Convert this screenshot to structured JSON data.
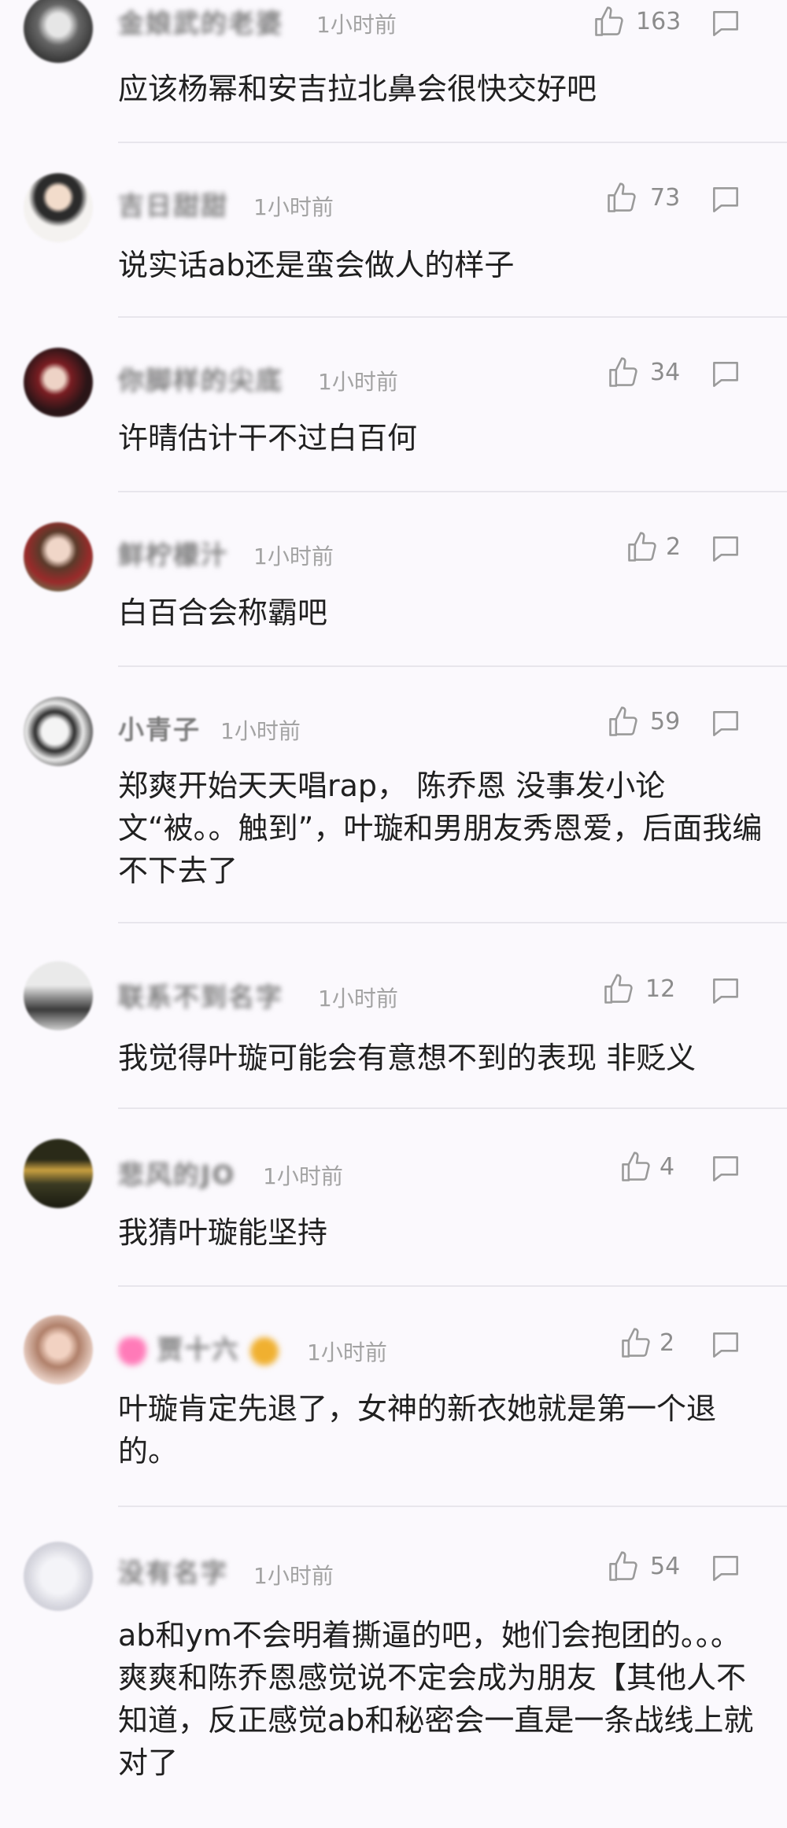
{
  "colors": {
    "background": "#fbf9fd",
    "text": "#202020",
    "meta": "#a3a3a3",
    "divider": "#e8e6ec"
  },
  "icons": {
    "like": "thumbs-up-outline-icon",
    "reply": "speech-bubble-outline-icon"
  },
  "comments": [
    {
      "username": "金娘武的老婆",
      "time": "1小时前",
      "likes": "163",
      "text": "应该杨幂和安吉拉北鼻会很快交好吧"
    },
    {
      "username": "吉日甜甜",
      "time": "1小时前",
      "likes": "73",
      "text": "说实话ab还是蛮会做人的样子"
    },
    {
      "username": "你脚样的尖底",
      "time": "1小时前",
      "likes": "34",
      "text": "许晴估计干不过白百何"
    },
    {
      "username": "鲜柠檬汁",
      "time": "1小时前",
      "likes": "2",
      "text": "白百合会称霸吧"
    },
    {
      "username": "小青子",
      "time": "1小时前",
      "likes": "59",
      "text": "郑爽开始天天唱rap， 陈乔恩 没事发小论文“被。。触到”，叶璇和男朋友秀恩爱，后面我编不下去了"
    },
    {
      "username": "联系不到名字",
      "time": "1小时前",
      "likes": "12",
      "text": "我觉得叶璇可能会有意想不到的表现 非贬义"
    },
    {
      "username": "悲风的JO",
      "time": "1小时前",
      "likes": "4",
      "text": "我猜叶璇能坚持"
    },
    {
      "username": "贾十六",
      "time": "1小时前",
      "likes": "2",
      "text": "叶璇肯定先退了，女神的新衣她就是第一个退的。"
    },
    {
      "username": "没有名字",
      "time": "1小时前",
      "likes": "54",
      "text": "ab和ym不会明着撕逼的吧，她们会抱团的。。。爽爽和陈乔恩感觉说不定会成为朋友【其他人不知道，反正感觉ab和秘密会一直是一条战线上就对了"
    }
  ]
}
